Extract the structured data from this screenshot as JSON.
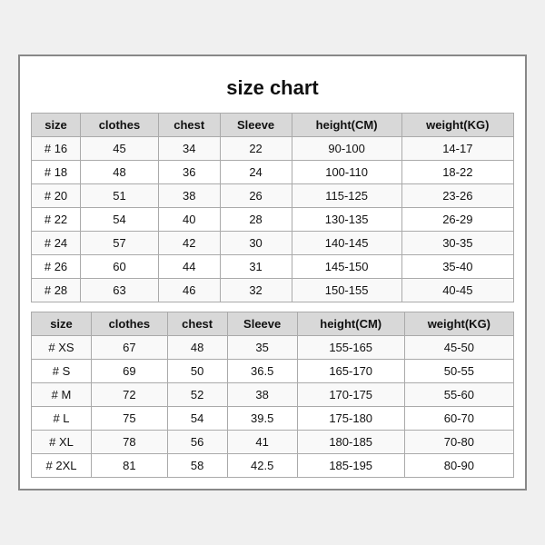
{
  "title": "size chart",
  "table1": {
    "headers": [
      "size",
      "clothes",
      "chest",
      "Sleeve",
      "height(CM)",
      "weight(KG)"
    ],
    "rows": [
      [
        "# 16",
        "45",
        "34",
        "22",
        "90-100",
        "14-17"
      ],
      [
        "# 18",
        "48",
        "36",
        "24",
        "100-110",
        "18-22"
      ],
      [
        "# 20",
        "51",
        "38",
        "26",
        "115-125",
        "23-26"
      ],
      [
        "# 22",
        "54",
        "40",
        "28",
        "130-135",
        "26-29"
      ],
      [
        "# 24",
        "57",
        "42",
        "30",
        "140-145",
        "30-35"
      ],
      [
        "# 26",
        "60",
        "44",
        "31",
        "145-150",
        "35-40"
      ],
      [
        "# 28",
        "63",
        "46",
        "32",
        "150-155",
        "40-45"
      ]
    ]
  },
  "table2": {
    "headers": [
      "size",
      "clothes",
      "chest",
      "Sleeve",
      "height(CM)",
      "weight(KG)"
    ],
    "rows": [
      [
        "# XS",
        "67",
        "48",
        "35",
        "155-165",
        "45-50"
      ],
      [
        "# S",
        "69",
        "50",
        "36.5",
        "165-170",
        "50-55"
      ],
      [
        "# M",
        "72",
        "52",
        "38",
        "170-175",
        "55-60"
      ],
      [
        "# L",
        "75",
        "54",
        "39.5",
        "175-180",
        "60-70"
      ],
      [
        "# XL",
        "78",
        "56",
        "41",
        "180-185",
        "70-80"
      ],
      [
        "# 2XL",
        "81",
        "58",
        "42.5",
        "185-195",
        "80-90"
      ]
    ]
  }
}
